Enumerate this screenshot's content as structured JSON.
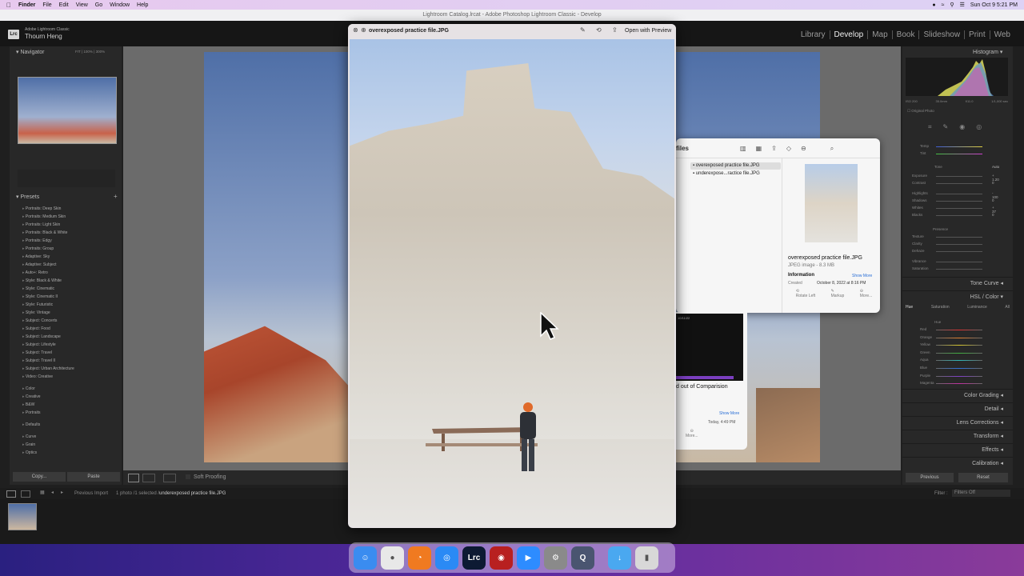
{
  "menubar": {
    "app": "Finder",
    "items": [
      "File",
      "Edit",
      "View",
      "Go",
      "Window",
      "Help"
    ],
    "clock": "Sun Oct 9  5:21 PM"
  },
  "window_title": "Lightroom Catalog.lrcat - Adobe Photoshop Lightroom Classic - Develop",
  "identity": {
    "app_name": "Adobe Lightroom Classic",
    "user": "Thourn Heng",
    "logo": "Lrc"
  },
  "modules": [
    "Library",
    "Develop",
    "Map",
    "Book",
    "Slideshow",
    "Print",
    "Web"
  ],
  "active_module": "Develop",
  "navigator": {
    "title": "Navigator",
    "zoom": [
      "FIT",
      "100%",
      "300%"
    ]
  },
  "presets": {
    "title": "Presets",
    "items": [
      "Portraits: Deep Skin",
      "Portraits: Medium Skin",
      "Portraits: Light Skin",
      "Portraits: Black & White",
      "Portraits: Edgy",
      "Portraits: Group",
      "Adaptive: Sky",
      "Adaptive: Subject",
      "Auto+: Retro",
      "Style: Black & White",
      "Style: Cinematic",
      "Style: Cinematic II",
      "Style: Futuristic",
      "Style: Vintage",
      "Subject: Concerts",
      "Subject: Food",
      "Subject: Landscape",
      "Subject: Lifestyle",
      "Subject: Travel",
      "Subject: Travel II",
      "Subject: Urban Architecture",
      "Video: Creative"
    ],
    "groups": [
      "Color",
      "Creative",
      "B&W",
      "Portraits"
    ],
    "defaults": "Defaults",
    "groups2": [
      "Curve",
      "Grain",
      "Optics"
    ]
  },
  "left_buttons": {
    "copy": "Copy...",
    "paste": "Paste"
  },
  "toolbar": {
    "soft_proofing": "Soft Proofing"
  },
  "histogram": {
    "title": "Histogram",
    "readout": [
      "ISO 200",
      "35.0mm",
      "f/11.0",
      "1/1,000 sec"
    ],
    "original_photo": "Original Photo"
  },
  "basic": {
    "temp": "Temp",
    "tint": "Tint",
    "tone": "Tone",
    "auto": "Auto",
    "rows": [
      {
        "label": "Exposure",
        "value": "+ 1.20"
      },
      {
        "label": "Contrast",
        "value": "0"
      },
      {
        "label": "Highlights",
        "value": "- 100"
      },
      {
        "label": "Shadows",
        "value": "0"
      },
      {
        "label": "Whites",
        "value": "+ 37"
      },
      {
        "label": "Blacks",
        "value": "0"
      }
    ],
    "presence": "Presence",
    "presence_rows": [
      "Texture",
      "Clarity",
      "Dehaze",
      "Vibrance",
      "Saturation"
    ]
  },
  "right_sections": [
    "Tone Curve",
    "HSL / Color"
  ],
  "hsl": {
    "tabs": [
      "Hue",
      "Saturation",
      "Luminance",
      "All"
    ],
    "group": "Hue",
    "colors": [
      "Red",
      "Orange",
      "Yellow",
      "Green",
      "Aqua",
      "Blue",
      "Purple",
      "Magenta"
    ]
  },
  "right_sections2": [
    "Color Grading",
    "Detail",
    "Lens Corrections",
    "Transform",
    "Effects",
    "Calibration"
  ],
  "right_buttons": {
    "previous": "Previous",
    "reset": "Reset"
  },
  "filmstrip": {
    "source": "Previous Import",
    "info": "1 photo /1 selected /",
    "file": "underexposed practice file.JPG",
    "filter_label": "Filter :",
    "filter_value": "Filters Off"
  },
  "finder": {
    "title_partial": "files",
    "files": [
      "overexposed practice file.JPG",
      "underexpose...ractice file.JPG"
    ],
    "preview_name": "overexposed practice file.JPG",
    "preview_meta": "JPEG image - 8.3 MB",
    "information": "Information",
    "show_more": "Show More",
    "created": "Created",
    "created_value": "October 8, 2022 at 8:16 PM",
    "actions": [
      "Rotate Left",
      "Markup",
      "More..."
    ],
    "second_caption": "d out of Comparision",
    "second_show_more": "Show More",
    "second_date": "Today, 4:49 PM",
    "second_more": "More...",
    "second_date_small": "10/11/22"
  },
  "quicklook": {
    "title": "overexposed practice file.JPG",
    "open_with": "Open with Preview"
  },
  "dock": [
    "Finder",
    "Chrome",
    "Firefox",
    "Safari",
    "Lrc",
    "Screen",
    "Zoom",
    "Settings",
    "QuickTime",
    "Downloads",
    "Trash"
  ]
}
